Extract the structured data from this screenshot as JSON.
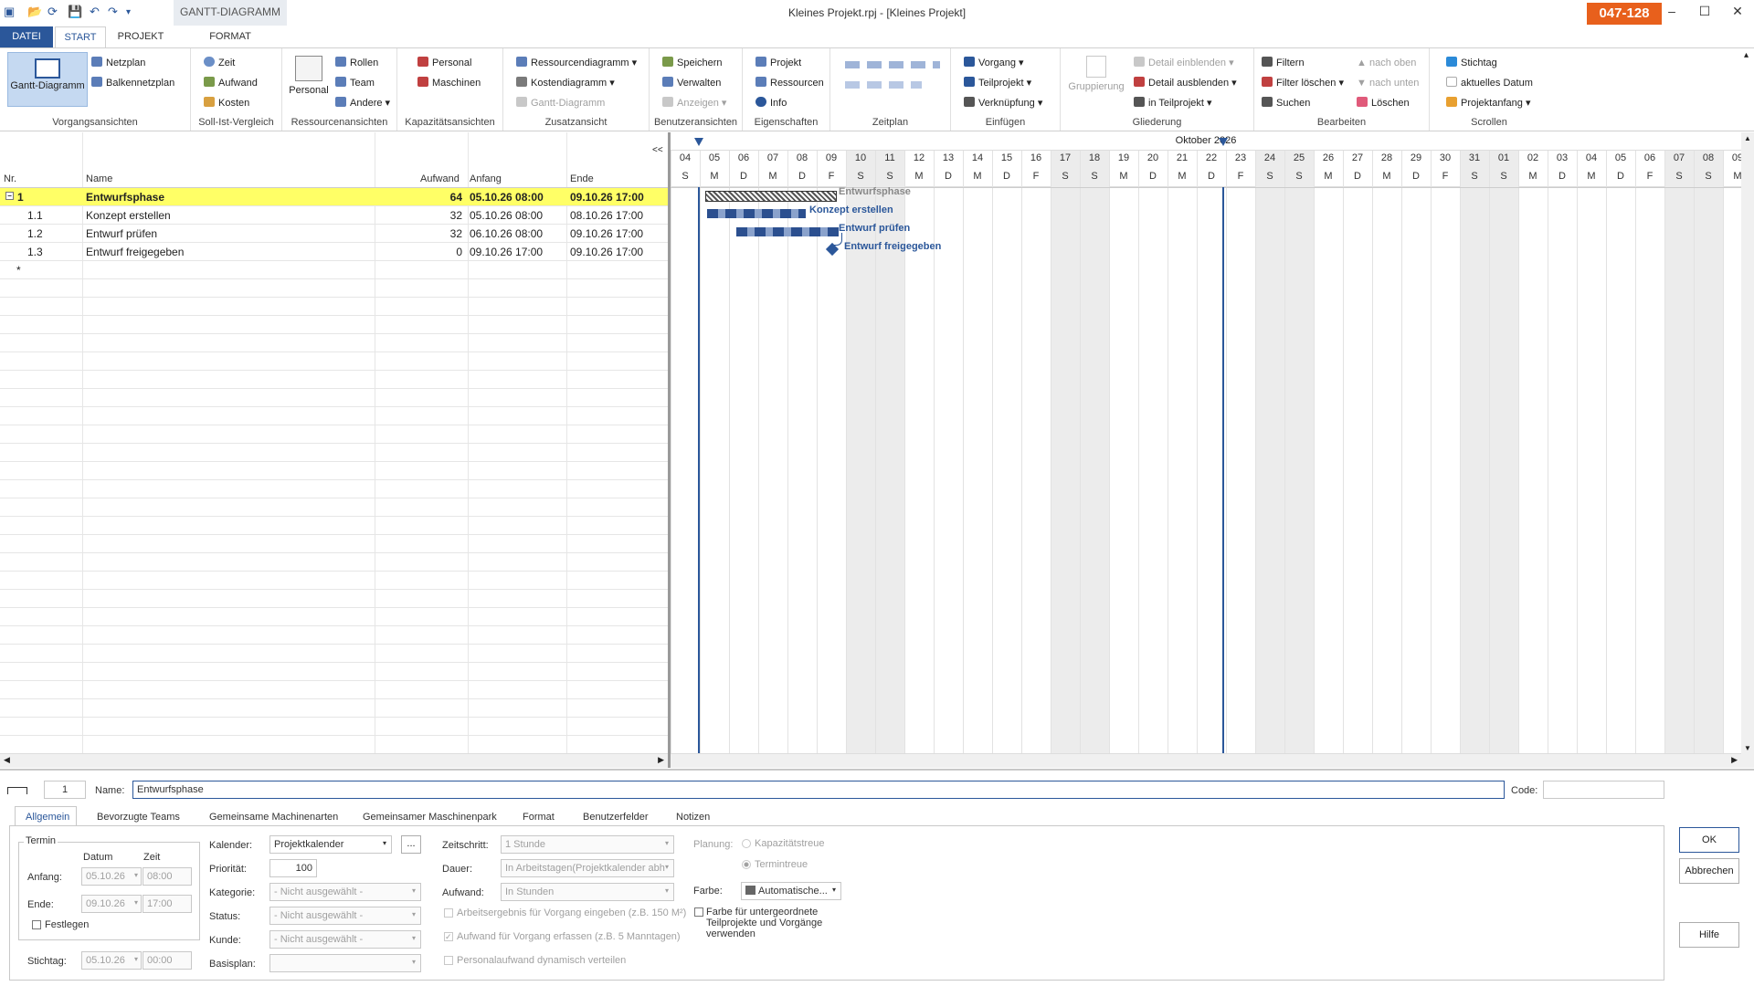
{
  "window": {
    "title": "Kleines Projekt.rpj - [Kleines Projekt]",
    "badge": "047-128",
    "context_tab": "GANTT-DIAGRAMM"
  },
  "tabs": [
    {
      "label": "DATEI"
    },
    {
      "label": "START"
    },
    {
      "label": "PROJEKT"
    },
    {
      "label": "FORMAT"
    }
  ],
  "ribbon": {
    "vorgangsansichten": {
      "label": "Vorgangsansichten",
      "gantt": "Gantt-Diagramm",
      "netzplan": "Netzplan",
      "balken": "Balkennetzplan"
    },
    "soll_ist": {
      "label": "Soll-Ist-Vergleich",
      "zeit": "Zeit",
      "aufwand": "Aufwand",
      "kosten": "Kosten"
    },
    "ressourcen": {
      "label": "Ressourcenansichten",
      "personal": "Personal",
      "rollen": "Rollen",
      "team": "Team",
      "andere": "Andere"
    },
    "kapazitaet": {
      "label": "Kapazitätsansichten",
      "personal": "Personal",
      "maschinen": "Maschinen"
    },
    "zusatz": {
      "label": "Zusatzansicht",
      "ressourcendiagramm": "Ressourcendiagramm",
      "kostendiagramm": "Kostendiagramm",
      "gantt": "Gantt-Diagramm"
    },
    "benutzer": {
      "label": "Benutzeransichten",
      "speichern": "Speichern",
      "verwalten": "Verwalten",
      "anzeigen": "Anzeigen"
    },
    "eigenschaften": {
      "label": "Eigenschaften",
      "projekt": "Projekt",
      "ressourcen": "Ressourcen",
      "info": "Info"
    },
    "zeitplan": {
      "label": "Zeitplan"
    },
    "einfuegen": {
      "label": "Einfügen",
      "vorgang": "Vorgang",
      "teilprojekt": "Teilprojekt",
      "verknuepfung": "Verknüpfung"
    },
    "gliederung": {
      "label": "Gliederung",
      "gruppierung": "Gruppierung",
      "detail_ein": "Detail einblenden",
      "detail_aus": "Detail ausblenden",
      "in_teilprojekt": "in Teilprojekt"
    },
    "bearbeiten": {
      "label": "Bearbeiten",
      "filtern": "Filtern",
      "filter_loeschen": "Filter löschen",
      "suchen": "Suchen",
      "nach_oben": "nach oben",
      "nach_unten": "nach unten",
      "loeschen": "Löschen"
    },
    "scrollen": {
      "label": "Scrollen",
      "stichtag": "Stichtag",
      "aktuelles_datum": "aktuelles Datum",
      "projektanfang": "Projektanfang"
    }
  },
  "grid": {
    "headers": {
      "nr": "Nr.",
      "name": "Name",
      "aufwand": "Aufwand",
      "anfang": "Anfang",
      "ende": "Ende"
    },
    "rows": [
      {
        "nr": "1",
        "name": "Entwurfsphase",
        "aufwand": "64",
        "anfang": "05.10.26 08:00",
        "ende": "09.10.26 17:00"
      },
      {
        "nr": "1.1",
        "name": "Konzept erstellen",
        "aufwand": "32",
        "anfang": "05.10.26 08:00",
        "ende": "08.10.26 17:00"
      },
      {
        "nr": "1.2",
        "name": "Entwurf prüfen",
        "aufwand": "32",
        "anfang": "06.10.26 08:00",
        "ende": "09.10.26 17:00"
      },
      {
        "nr": "1.3",
        "name": "Entwurf freigegeben",
        "aufwand": "0",
        "anfang": "09.10.26 17:00",
        "ende": "09.10.26 17:00"
      }
    ],
    "new_row_marker": "*",
    "collapse": "<<"
  },
  "gantt": {
    "month": "Oktober 2026",
    "days": [
      "04",
      "05",
      "06",
      "07",
      "08",
      "09",
      "10",
      "11",
      "12",
      "13",
      "14",
      "15",
      "16",
      "17",
      "18",
      "19",
      "20",
      "21",
      "22",
      "23",
      "24",
      "25",
      "26",
      "27",
      "28",
      "29",
      "30",
      "31",
      "01",
      "02",
      "03",
      "04",
      "05",
      "06",
      "07",
      "08",
      "09"
    ],
    "letters": [
      "S",
      "M",
      "D",
      "M",
      "D",
      "F",
      "S",
      "S",
      "M",
      "D",
      "M",
      "D",
      "F",
      "S",
      "S",
      "M",
      "D",
      "M",
      "D",
      "F",
      "S",
      "S",
      "M",
      "D",
      "M",
      "D",
      "F",
      "S",
      "S",
      "M",
      "D",
      "M",
      "D",
      "F",
      "S",
      "S",
      "M"
    ],
    "bar_labels": [
      "Entwurfsphase",
      "Konzept erstellen",
      "Entwurf prüfen",
      "Entwurf freigegeben"
    ]
  },
  "detail": {
    "id": "1",
    "name_label": "Name:",
    "name_value": "Entwurfsphase",
    "code_label": "Code:",
    "code_value": "",
    "tabs": [
      "Allgemein",
      "Bevorzugte Teams",
      "Gemeinsame Machinenarten",
      "Gemeinsamer Maschinenpark",
      "Format",
      "Benutzerfelder",
      "Notizen"
    ],
    "termin": {
      "title": "Termin",
      "datum": "Datum",
      "zeit": "Zeit",
      "anfang_label": "Anfang:",
      "anfang_datum": "05.10.26",
      "anfang_zeit": "08:00",
      "ende_label": "Ende:",
      "ende_datum": "09.10.26",
      "ende_zeit": "17:00",
      "festlegen": "Festlegen"
    },
    "stichtag": {
      "label": "Stichtag:",
      "datum": "05.10.26",
      "zeit": "00:00"
    },
    "kalender": {
      "label": "Kalender:",
      "value": "Projektkalender",
      "btn": "..."
    },
    "prioritaet": {
      "label": "Priorität:",
      "value": "100"
    },
    "kategorie": {
      "label": "Kategorie:",
      "value": "- Nicht ausgewählt -"
    },
    "status": {
      "label": "Status:",
      "value": "- Nicht ausgewählt -"
    },
    "kunde": {
      "label": "Kunde:",
      "value": "- Nicht ausgewählt -"
    },
    "basisplan": {
      "label": "Basisplan:",
      "value": ""
    },
    "zeitschritt": {
      "label": "Zeitschritt:",
      "value": "1 Stunde"
    },
    "dauer": {
      "label": "Dauer:",
      "value": "In Arbeitstagen(Projektkalender abh"
    },
    "aufwand": {
      "label": "Aufwand:",
      "value": "In Stunden"
    },
    "cb1": "Arbeitsergebnis für Vorgang eingeben (z.B. 150 M²)",
    "cb2": "Aufwand für Vorgang erfassen (z.B. 5 Manntagen)",
    "cb3": "Personalaufwand dynamisch verteilen",
    "planung": {
      "label": "Planung:",
      "opt1": "Kapazitätstreue",
      "opt2": "Termintreue"
    },
    "farbe": {
      "label": "Farbe:",
      "value": "Automatische..."
    },
    "farbe_cb": "Farbe für untergeordnete Teilprojekte und Vorgänge verwenden",
    "ok": "OK",
    "abbrechen": "Abbrechen",
    "hilfe": "Hilfe"
  }
}
